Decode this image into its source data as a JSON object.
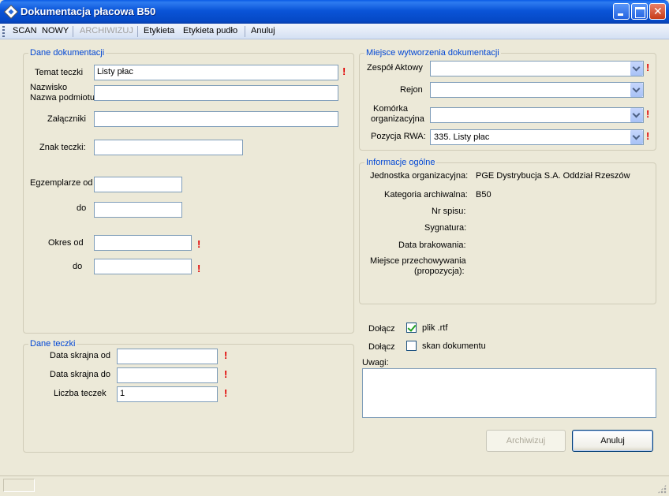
{
  "window": {
    "title": "Dokumentacja płacowa B50"
  },
  "menu": {
    "scan": "SCAN",
    "nowy": "NOWY",
    "archiwizuj": "ARCHIWIZUJ",
    "etykieta": "Etykieta",
    "etykieta_pudlo": "Etykieta pudło",
    "anuluj": "Anuluj"
  },
  "dane_dokumentacji": {
    "legend": "Dane dokumentacji",
    "temat_label": "Temat teczki",
    "temat_value": "Listy płac",
    "nazwisko_label": "Nazwisko",
    "nazwa_label": "Nazwa podmiotu",
    "nazwisko_value": "",
    "zalaczniki_label": "Załączniki",
    "zalaczniki_value": "",
    "znak_label": "Znak teczki:",
    "znak_value": "",
    "egz_od_label": "Egzemplarze od",
    "egz_od_value": "",
    "egz_do_label": "do",
    "egz_do_value": "",
    "okres_od_label": "Okres od",
    "okres_od_value": "",
    "okres_do_label": "do",
    "okres_do_value": ""
  },
  "dane_teczki": {
    "legend": "Dane teczki",
    "data_od_label": "Data skrajna od",
    "data_od_value": "",
    "data_do_label": "Data skrajna do",
    "data_do_value": "",
    "liczba_label": "Liczba teczek",
    "liczba_value": "1"
  },
  "miejsce": {
    "legend": "Miejsce wytworzenia dokumentacji",
    "zespol_label": "Zespół Aktowy",
    "zespol_value": "",
    "rejon_label": "Rejon",
    "rejon_value": "",
    "komorka_label1": "Komórka",
    "komorka_label2": "organizacyjna",
    "komorka_value": "",
    "pozycja_label": "Pozycja RWA:",
    "pozycja_value": "335. Listy płac"
  },
  "info": {
    "legend": "Informacje ogólne",
    "jednostka_label": "Jednostka organizacyjna:",
    "jednostka_value": "PGE Dystrybucja S.A. Oddział Rzeszów",
    "kategoria_label": "Kategoria archiwalna:",
    "kategoria_value": "B50",
    "nrspisu_label": "Nr spisu:",
    "sygnatura_label": "Sygnatura:",
    "data_brak_label": "Data brakowania:",
    "miejsce_label1": "Miejsce przechowywania",
    "miejsce_label2": "(propozycja):"
  },
  "attach": {
    "dolacz1": "Dołącz",
    "plik": "plik .rtf",
    "plik_checked": true,
    "dolacz2": "Dołącz",
    "skan": "skan dokumentu",
    "skan_checked": false,
    "uwagi_label": "Uwagi:",
    "uwagi_value": ""
  },
  "buttons": {
    "archiwizuj": "Archiwizuj",
    "anuluj": "Anuluj"
  },
  "required_mark": "!"
}
